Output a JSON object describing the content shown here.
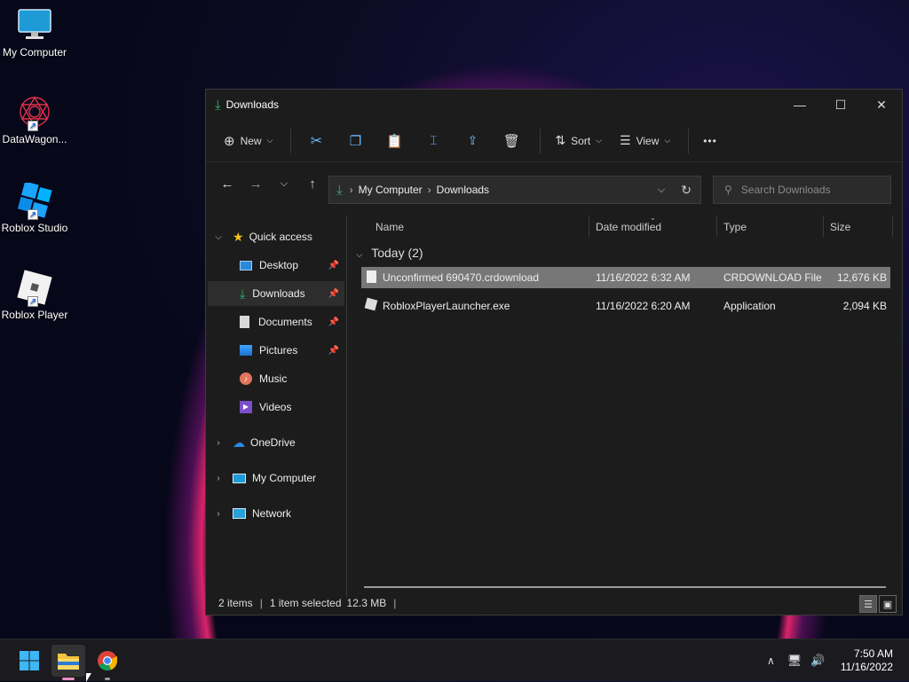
{
  "desktop": {
    "icons": [
      {
        "label": "My Computer"
      },
      {
        "label": "DataWagon..."
      },
      {
        "label": "Roblox Studio"
      },
      {
        "label": "Roblox Player"
      }
    ]
  },
  "window": {
    "title": "Downloads",
    "toolbar": {
      "new_label": "New",
      "sort_label": "Sort",
      "view_label": "View",
      "more_label": "•••"
    },
    "address": {
      "crumbs": [
        "My Computer",
        "Downloads"
      ]
    },
    "search": {
      "placeholder": "Search Downloads"
    },
    "sidebar": {
      "quick_access": "Quick access",
      "items": [
        {
          "label": "Desktop",
          "pinned": true
        },
        {
          "label": "Downloads",
          "pinned": true,
          "selected": true
        },
        {
          "label": "Documents",
          "pinned": true
        },
        {
          "label": "Pictures",
          "pinned": true
        },
        {
          "label": "Music",
          "pinned": false
        },
        {
          "label": "Videos",
          "pinned": false
        }
      ],
      "roots": [
        {
          "label": "OneDrive"
        },
        {
          "label": "My Computer"
        },
        {
          "label": "Network"
        }
      ]
    },
    "columns": [
      "Name",
      "Date modified",
      "Type",
      "Size"
    ],
    "group_label": "Today (2)",
    "files": [
      {
        "name": "Unconfirmed 690470.crdownload",
        "date": "11/16/2022 6:32 AM",
        "type": "CRDOWNLOAD File",
        "size": "12,676 KB",
        "selected": true
      },
      {
        "name": "RobloxPlayerLauncher.exe",
        "date": "11/16/2022 6:20 AM",
        "type": "Application",
        "size": "2,094 KB",
        "selected": false
      }
    ],
    "status": {
      "items": "2 items",
      "selected": "1 item selected",
      "size": "12.3 MB"
    }
  },
  "taskbar": {
    "time": "7:50 AM",
    "date": "11/16/2022"
  },
  "colors": {
    "accent_download": "#2fb36b",
    "selection": "#777777",
    "window_bg": "#1c1c1c"
  }
}
